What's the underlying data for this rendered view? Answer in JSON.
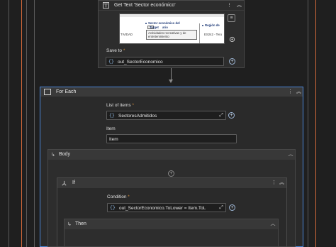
{
  "get_text": {
    "title": "Get Text 'Sector económico'",
    "menu_icon": "more-vertical-icon",
    "collapse_icon": "collapse-icon",
    "preview": {
      "left_text": "TIVIDAD",
      "title_line1": "Sector económico del",
      "title_line2": "ario",
      "tag_text": "Target",
      "selected_text_line1": "Actividades recreativas y de",
      "selected_text_line2": "entretenimiento",
      "right_title": "Región de",
      "right_value": "ES242 - Teru"
    },
    "save_to_label": "Save to",
    "save_to_value": "out_SectorEconomico"
  },
  "for_each": {
    "title": "For Each",
    "list_label": "List of items",
    "list_value": "SectoresAdmitidos",
    "item_label": "Item",
    "item_value": "Item"
  },
  "body": {
    "title": "Body"
  },
  "if_block": {
    "title": "If",
    "condition_label": "Condition",
    "condition_value": "out_SectorEconomico.ToLower = Item.ToL"
  },
  "then": {
    "title": "Then"
  },
  "colors": {
    "accent_blue": "#4a86d8",
    "rail_orange": "#d2693a",
    "background": "#1f1f1f"
  }
}
